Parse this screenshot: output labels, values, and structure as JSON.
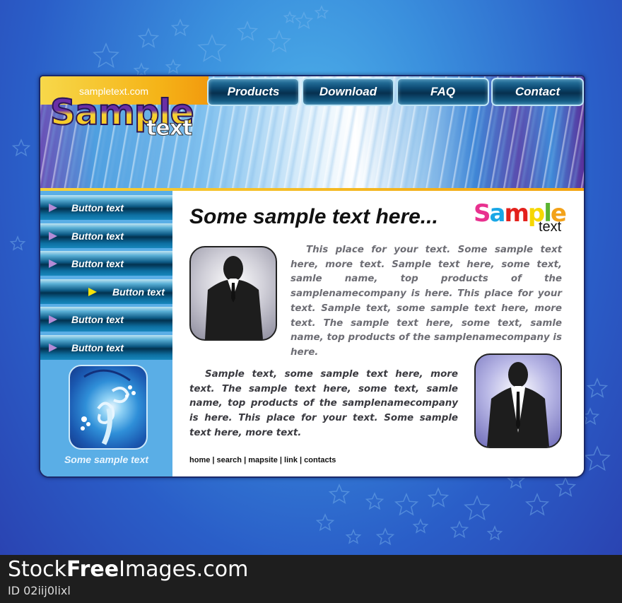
{
  "site": {
    "url_text": "sampletext.com",
    "logo_main": "Sample",
    "logo_sub": "text"
  },
  "nav": {
    "items": [
      {
        "label": "Products"
      },
      {
        "label": "Download"
      },
      {
        "label": "FAQ"
      },
      {
        "label": "Contact"
      }
    ]
  },
  "sidebar": {
    "items": [
      {
        "label": "Button text",
        "active": false
      },
      {
        "label": "Button text",
        "active": false
      },
      {
        "label": "Button text",
        "active": false
      },
      {
        "label": "Button text",
        "active": true
      },
      {
        "label": "Button text",
        "active": false
      },
      {
        "label": "Button text",
        "active": false
      }
    ],
    "caption": "Some sample text"
  },
  "main": {
    "title": "Some sample text here...",
    "brand": {
      "letters": [
        {
          "ch": "S",
          "color": "#e8318f"
        },
        {
          "ch": "a",
          "color": "#1aa7e6"
        },
        {
          "ch": "m",
          "color": "#e3211c"
        },
        {
          "ch": "p",
          "color": "#f6d700"
        },
        {
          "ch": "l",
          "color": "#5bb431"
        },
        {
          "ch": "e",
          "color": "#f3a21a"
        }
      ],
      "sub": "text"
    },
    "paragraph1": "This place for your text. Some sample text here, more text. Sample text here, some text, samle name, top products of the samplenamecompany is here. This place for your text. Sample text, some sample text here, more text. The sample text here, some text, samle name, top products of the samplenamecompany is here.",
    "paragraph2": "Sample text, some sample text here, more text. The sample text here, some text, samle name, top products of the samplenamecompany is here. This place for your text. Some sample text here, more text.",
    "footer_links": [
      "home",
      "search",
      "mapsite",
      "link",
      "contacts"
    ],
    "footer_separator": " | "
  },
  "watermark": {
    "prefix": "Stock",
    "bold": "Free",
    "suffix": "Images.com",
    "id": "ID 02iij0lixl"
  }
}
